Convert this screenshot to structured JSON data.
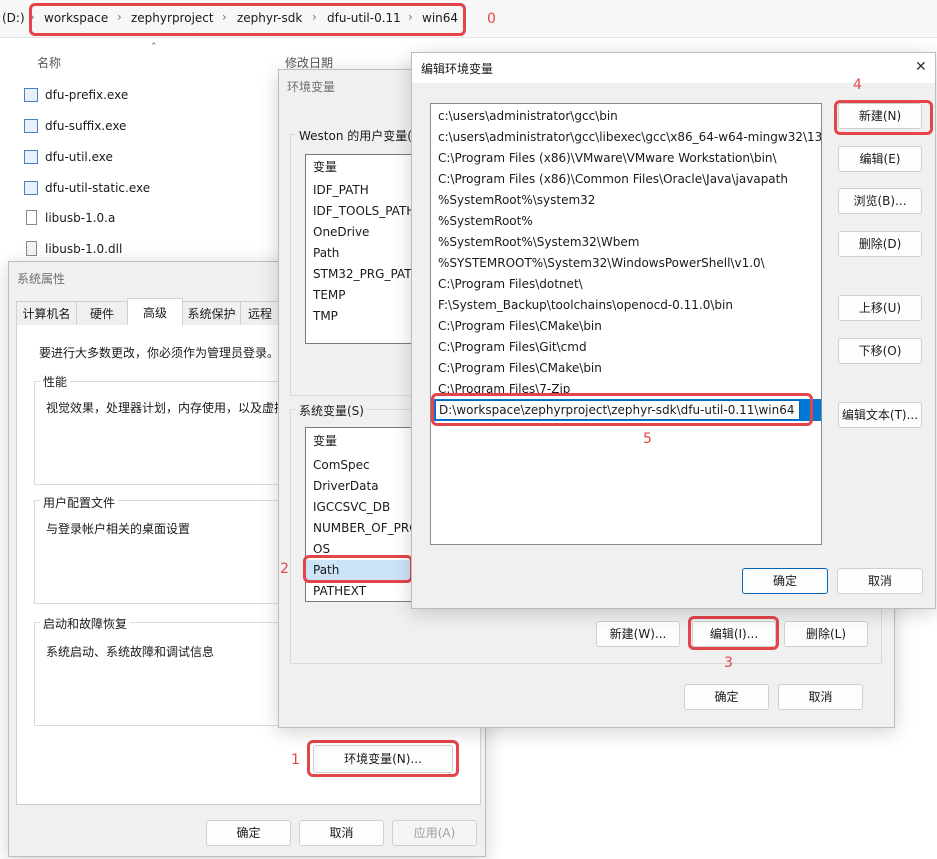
{
  "explorer": {
    "breadcrumb": {
      "drive": "(D:)",
      "items": [
        "workspace",
        "zephyrproject",
        "zephyr-sdk",
        "dfu-util-0.11",
        "win64"
      ],
      "annotation": "0"
    },
    "columns": {
      "name": "名称",
      "modified": "修改日期"
    },
    "files": [
      {
        "name": "dfu-prefix.exe",
        "icon": "exe-icon"
      },
      {
        "name": "dfu-suffix.exe",
        "icon": "exe-icon"
      },
      {
        "name": "dfu-util.exe",
        "icon": "exe-icon"
      },
      {
        "name": "dfu-util-static.exe",
        "icon": "exe-icon"
      },
      {
        "name": "libusb-1.0.a",
        "icon": "file-icon"
      },
      {
        "name": "libusb-1.0.dll",
        "icon": "dll-icon"
      }
    ]
  },
  "sysprops": {
    "title": "系统属性",
    "tabs": [
      "计算机名",
      "硬件",
      "高级",
      "系统保护",
      "远程"
    ],
    "active_tab": "高级",
    "admin_notice": "要进行大多数更改，你必须作为管理员登录。",
    "performance": {
      "label": "性能",
      "desc": "视觉效果，处理器计划，内存使用，以及虚拟"
    },
    "profiles": {
      "label": "用户配置文件",
      "desc": "与登录帐户相关的桌面设置"
    },
    "startup": {
      "label": "启动和故障恢复",
      "desc": "系统启动、系统故障和调试信息"
    },
    "env_button": "环境变量(N)...",
    "env_annotation": "1",
    "ok": "确定",
    "cancel": "取消",
    "apply": "应用(A)"
  },
  "envvars": {
    "title": "环境变量",
    "user_section": "Weston 的用户变量(",
    "user_header": "变量",
    "user_vars": [
      "IDF_PATH",
      "IDF_TOOLS_PATH",
      "OneDrive",
      "Path",
      "STM32_PRG_PATH",
      "TEMP",
      "TMP"
    ],
    "system_section": "系统变量(S)",
    "system_header": "变量",
    "system_vars": [
      "ComSpec",
      "DriverData",
      "IGCCSVC_DB",
      "NUMBER_OF_PRO",
      "OS",
      "Path",
      "PATHEXT"
    ],
    "path_annotation": "2",
    "new_btn": "新建(W)...",
    "edit_btn": "编辑(I)...",
    "edit_annotation": "3",
    "delete_btn": "删除(L)",
    "ok": "确定",
    "cancel": "取消"
  },
  "editenv": {
    "title": "编辑环境变量",
    "close": "✕",
    "paths": [
      "c:\\users\\administrator\\gcc\\bin",
      "c:\\users\\administrator\\gcc\\libexec\\gcc\\x86_64-w64-mingw32\\13...",
      "C:\\Program Files (x86)\\VMware\\VMware Workstation\\bin\\",
      "C:\\Program Files (x86)\\Common Files\\Oracle\\Java\\javapath",
      "%SystemRoot%\\system32",
      "%SystemRoot%",
      "%SystemRoot%\\System32\\Wbem",
      "%SYSTEMROOT%\\System32\\WindowsPowerShell\\v1.0\\",
      "C:\\Program Files\\dotnet\\",
      "F:\\System_Backup\\toolchains\\openocd-0.11.0\\bin",
      "C:\\Program Files\\CMake\\bin",
      "C:\\Program Files\\Git\\cmd",
      "C:\\Program Files\\CMake\\bin",
      "C:\\Program Files\\7-Zip"
    ],
    "new_entry": "D:\\workspace\\zephyrproject\\zephyr-sdk\\dfu-util-0.11\\win64",
    "entry_annotation": "5",
    "buttons": {
      "new": "新建(N)",
      "edit": "编辑(E)",
      "browse": "浏览(B)...",
      "delete": "删除(D)",
      "up": "上移(U)",
      "down": "下移(O)",
      "edit_text": "编辑文本(T)..."
    },
    "new_annotation": "4",
    "ok": "确定",
    "cancel": "取消"
  },
  "colors": {
    "annotation": "#e3454a",
    "accent": "#0067c0"
  }
}
